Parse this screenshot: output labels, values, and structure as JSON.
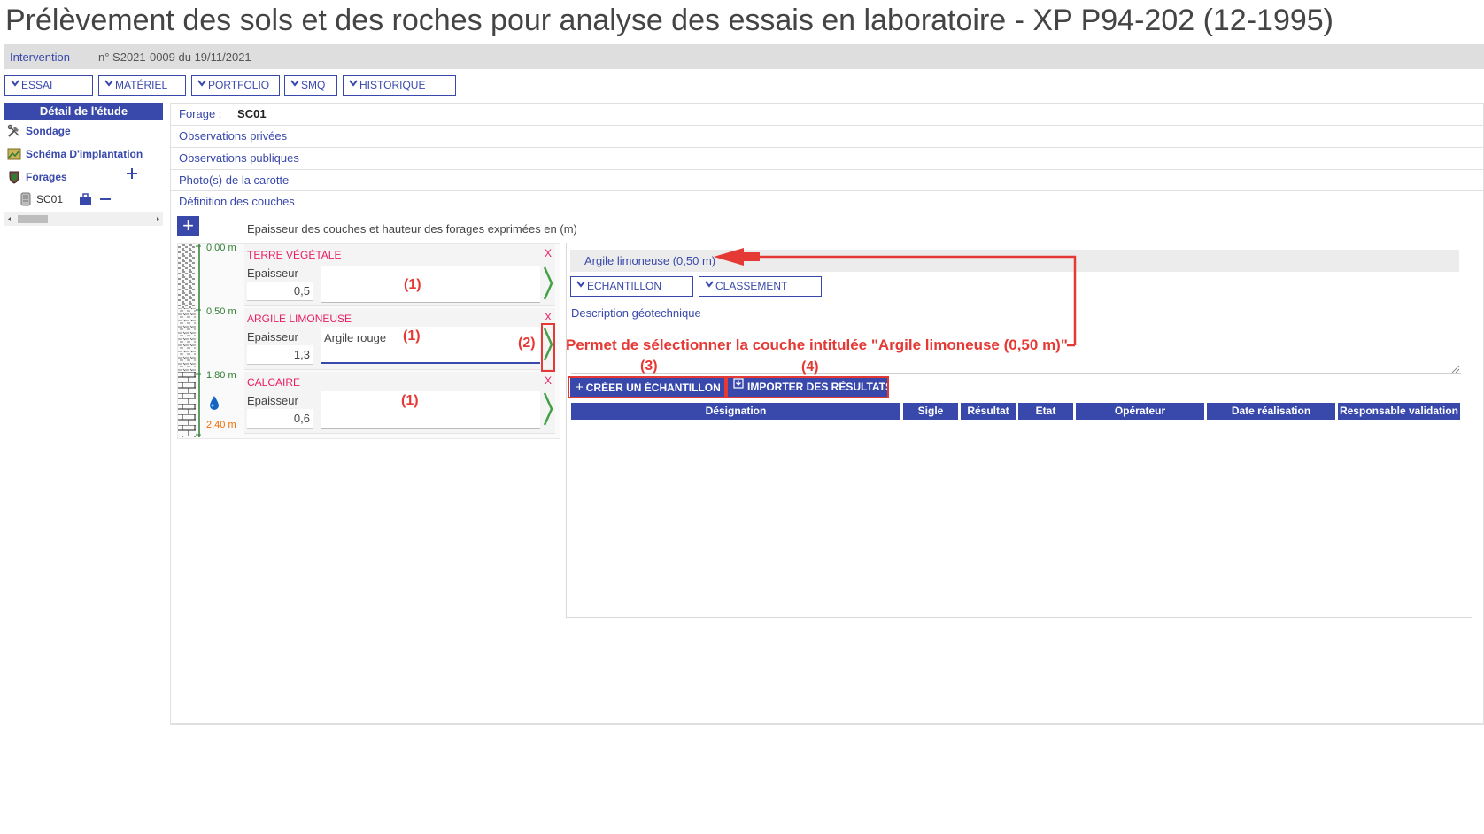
{
  "page": {
    "title": "Prélèvement des sols et des roches pour analyse des essais en laboratoire - XP P94-202 (12-1995)"
  },
  "intervention": {
    "label": "Intervention",
    "value": "n° S2021-0009 du 19/11/2021"
  },
  "toolbar": {
    "menus": [
      {
        "label": "ESSAI"
      },
      {
        "label": "MATÉRIEL"
      },
      {
        "label": "PORTFOLIO"
      },
      {
        "label": "SMQ"
      },
      {
        "label": "HISTORIQUE"
      }
    ]
  },
  "sidebar": {
    "header": "Détail de l'étude",
    "items": [
      {
        "label": "Sondage",
        "icon": "tools-icon"
      },
      {
        "label": "Schéma D'implantation",
        "icon": "map-icon"
      },
      {
        "label": "Forages",
        "icon": "shield-icon"
      }
    ],
    "sub_item": "SC01"
  },
  "forage": {
    "label": "Forage :",
    "value": "SC01"
  },
  "sections": {
    "observations_privees": "Observations privées",
    "observations_publiques": "Observations publiques",
    "photos": "Photo(s) de la carotte",
    "definition": "Définition des couches"
  },
  "units_note": "Epaisseur des couches et hauteur des forages exprimées en (m)",
  "depths": [
    "0,00 m",
    "0,50 m",
    "1,80 m",
    "2,40 m"
  ],
  "layers": [
    {
      "name": "TERRE VÉGÉTALE",
      "epaisseur_label": "Epaisseur",
      "epaisseur": "0,5",
      "description": "",
      "remove": "X"
    },
    {
      "name": "ARGILE LIMONEUSE",
      "epaisseur_label": "Epaisseur",
      "epaisseur": "1,3",
      "description": "Argile rouge",
      "remove": "X"
    },
    {
      "name": "CALCAIRE",
      "epaisseur_label": "Epaisseur",
      "epaisseur": "0,6",
      "description": "",
      "remove": "X"
    }
  ],
  "selected_layer": {
    "title": "Argile limoneuse (0,50 m)",
    "menus": [
      "ECHANTILLON",
      "CLASSEMENT"
    ],
    "description_label": "Description géotechnique"
  },
  "actions": {
    "create_sample": "CRÉER UN ÉCHANTILLON",
    "import_results": "IMPORTER DES RÉSULTATS"
  },
  "table": {
    "headers": [
      "Désignation",
      "Sigle",
      "Résultat",
      "Etat",
      "Opérateur",
      "Date réalisation",
      "Responsable validation"
    ]
  },
  "annotations": {
    "markers": [
      "(1)",
      "(1)",
      "(1)",
      "(2)",
      "(3)",
      "(4)"
    ],
    "note": "Permet de sélectionner la couche intitulée \"Argile limoneuse (0,50 m)\""
  },
  "colors": {
    "primary": "#3949ab",
    "annotation": "#e53935",
    "layer_name": "#e91e63",
    "depth": "#2e7d32",
    "water": "#ef6c00"
  }
}
